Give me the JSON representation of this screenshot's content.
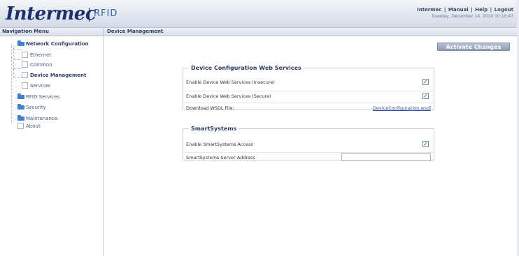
{
  "header": {
    "logo_text": "Intermec",
    "product": "RFID",
    "links": [
      "Intermec",
      "Manual",
      "Help",
      "Logout"
    ],
    "datetime": "Tuesday, December 14, 2010 10:10:47"
  },
  "tabs": {
    "nav_title": "Navigation Menu",
    "main_title": "Device Management"
  },
  "sidebar": {
    "items": [
      {
        "label": "Network Configuration",
        "icon": "folder-icon"
      },
      {
        "label": "Ethernet",
        "icon": "page-icon"
      },
      {
        "label": "Common",
        "icon": "page-icon"
      },
      {
        "label": "Device Management",
        "icon": "page-icon"
      },
      {
        "label": "Services",
        "icon": "page-icon"
      },
      {
        "label": "RFID Services",
        "icon": "folder-icon"
      },
      {
        "label": "Security",
        "icon": "folder-icon"
      },
      {
        "label": "Maintenance",
        "icon": "folder-icon"
      },
      {
        "label": "About",
        "icon": "page-icon"
      }
    ]
  },
  "main": {
    "activate_button": "Activate Changes",
    "web_services": {
      "legend": "Device Configuration Web Services",
      "rows": [
        {
          "label": "Enable Device Web Services (Insecure)",
          "checked": true
        },
        {
          "label": "Enable Device Web Services (Secure)",
          "checked": true
        },
        {
          "label": "Download WSDL File:",
          "link": "DeviceConfiguration.wsdl"
        }
      ]
    },
    "smart_systems": {
      "legend": "SmartSystems",
      "rows": [
        {
          "label": "Enable SmartSystems Access",
          "checked": true
        },
        {
          "label": "SmartSystems Server Address",
          "value": ""
        }
      ]
    },
    "check_mark": "✓"
  },
  "colors": {
    "brand": "#1b2f6b",
    "accent": "#3f7fd4",
    "button": "#8e9db5"
  }
}
